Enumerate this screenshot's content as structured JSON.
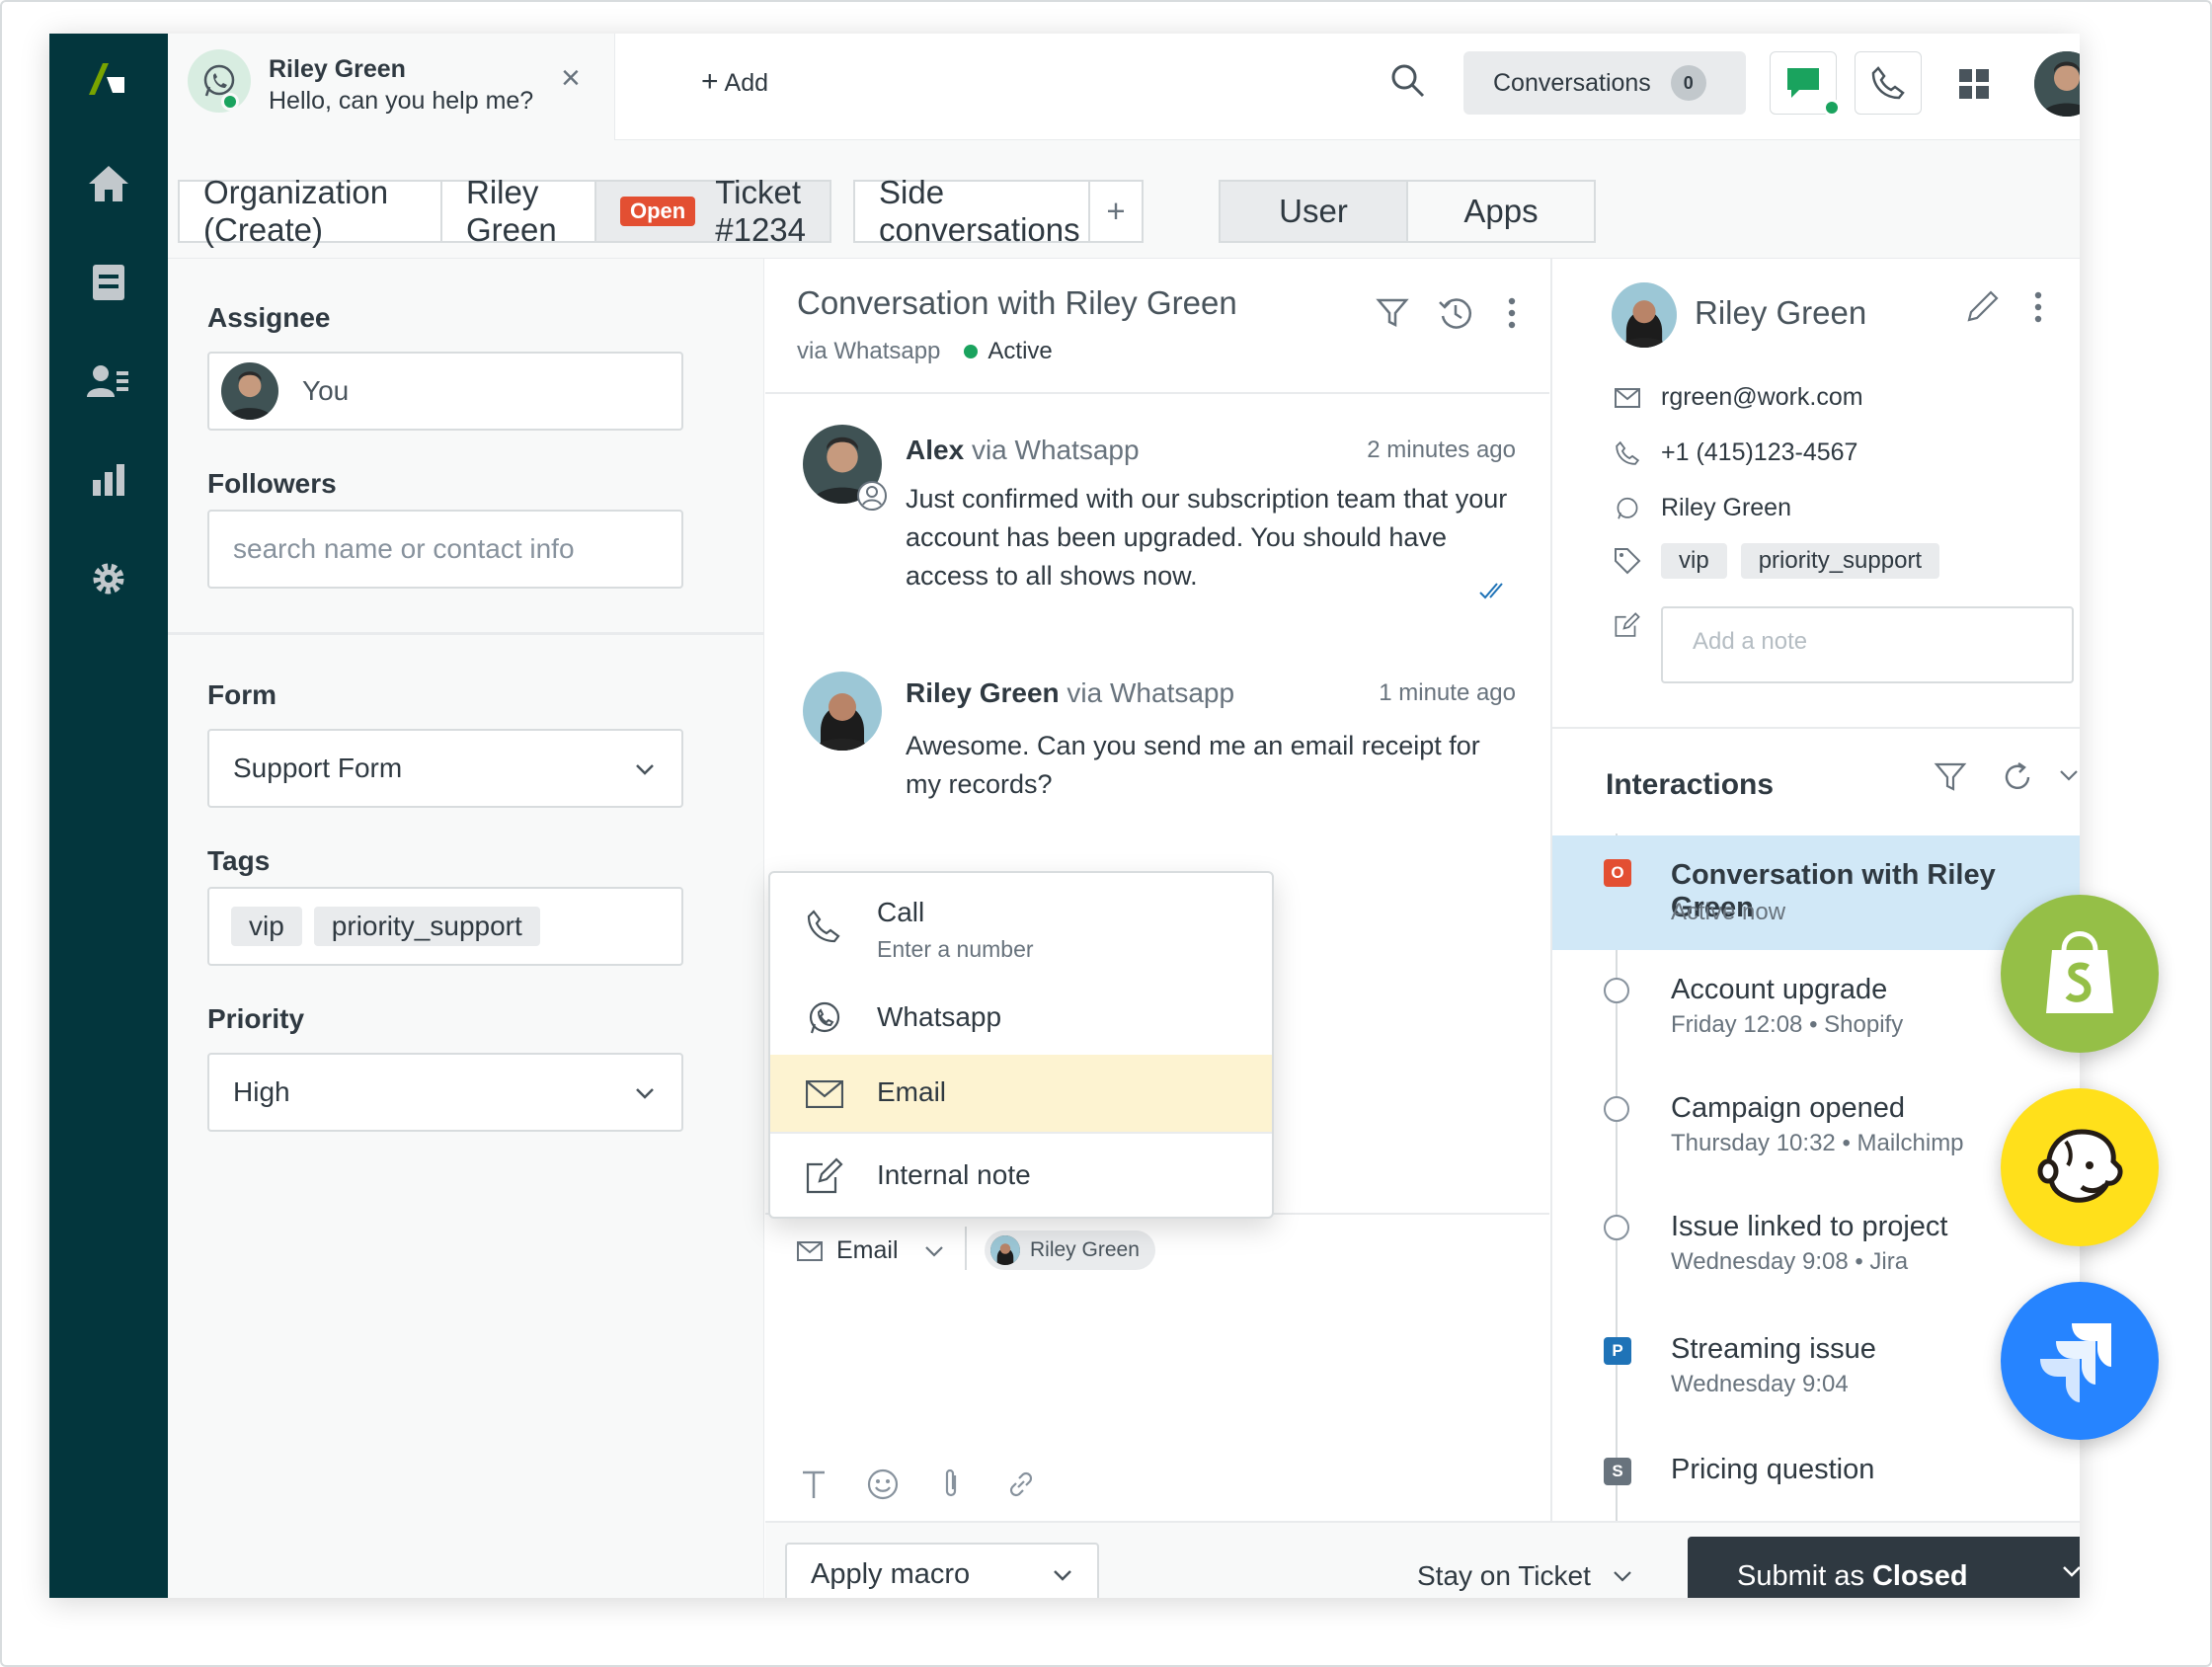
{
  "topbar": {
    "chat_tab": {
      "name": "Riley Green",
      "message": "Hello, can you help me?",
      "close": "×"
    },
    "add_label": "Add",
    "conversations_label": "Conversations",
    "conversations_count": "0"
  },
  "tabs": {
    "organization": "Organization (Create)",
    "requester": "Riley Green",
    "status_badge": "Open",
    "ticket": "Ticket #1234",
    "side_conversations": "Side conversations",
    "add_side": "+",
    "user": "User",
    "apps": "Apps"
  },
  "properties": {
    "assignee_label": "Assignee",
    "assignee_value": "You",
    "followers_label": "Followers",
    "followers_placeholder": "search name or contact info",
    "form_label": "Form",
    "form_value": "Support Form",
    "tags_label": "Tags",
    "tags": [
      "vip",
      "priority_support"
    ],
    "priority_label": "Priority",
    "priority_value": "High"
  },
  "conversation": {
    "title": "Conversation with Riley Green",
    "via": "via Whatsapp",
    "status": "Active",
    "messages": [
      {
        "author": "Alex",
        "channel": "via Whatsapp",
        "time": "2 minutes ago",
        "body": "Just confirmed with our subscription team that your account has been upgraded. You should have access to all shows now."
      },
      {
        "author": "Riley Green",
        "channel": "via Whatsapp",
        "time": "1 minute ago",
        "body": "Awesome. Can you send me an email receipt for my records?"
      }
    ],
    "composer": {
      "channel": "Email",
      "recipient": "Riley Green"
    }
  },
  "channel_menu": {
    "items": [
      {
        "label": "Call",
        "sub": "Enter a number"
      },
      {
        "label": "Whatsapp"
      },
      {
        "label": "Email"
      },
      {
        "label": "Internal note"
      }
    ]
  },
  "footer": {
    "macro": "Apply macro",
    "stay": "Stay on Ticket",
    "submit_prefix": "Submit as",
    "submit_status": "Closed"
  },
  "user_panel": {
    "name": "Riley Green",
    "email": "rgreen@work.com",
    "phone": "+1 (415)123-4567",
    "whatsapp": "Riley Green",
    "tags": [
      "vip",
      "priority_support"
    ],
    "note_placeholder": "Add a note"
  },
  "interactions": {
    "title": "Interactions",
    "items": [
      {
        "name": "Conversation with Riley Green",
        "sub": "Active now",
        "marker": "O"
      },
      {
        "name": "Account upgrade",
        "sub": "Friday 12:08 • Shopify"
      },
      {
        "name": "Campaign opened",
        "sub": "Thursday 10:32 • Mailchimp"
      },
      {
        "name": "Issue linked to project",
        "sub": "Wednesday 9:08 • Jira"
      },
      {
        "name": "Streaming issue",
        "sub": "Wednesday 9:04",
        "marker": "P"
      },
      {
        "name": "Pricing question",
        "sub": "",
        "marker": "S"
      }
    ]
  },
  "colors": {
    "sidebar": "#03363d",
    "open_badge": "#e34f32",
    "active_green": "#1aa35e",
    "highlight_blue": "#d1e8f7",
    "menu_highlight": "#fdf3d1",
    "shopify": "#95bf47",
    "mailchimp": "#ffe01b",
    "jira": "#2684ff"
  },
  "icons": [
    "zendesk-logo-icon",
    "home-icon",
    "views-icon",
    "customers-icon",
    "reporting-icon",
    "settings-icon",
    "whatsapp-icon",
    "search-icon",
    "chat-icon",
    "phone-icon",
    "apps-grid-icon",
    "filter-icon",
    "history-icon",
    "more-icon",
    "check-icon",
    "mail-icon",
    "tag-icon",
    "note-icon",
    "edit-icon",
    "refresh-icon",
    "chevron-down-icon",
    "text-format-icon",
    "emoji-icon",
    "attachment-icon",
    "link-icon",
    "shopify-icon",
    "mailchimp-icon",
    "jira-icon"
  ]
}
